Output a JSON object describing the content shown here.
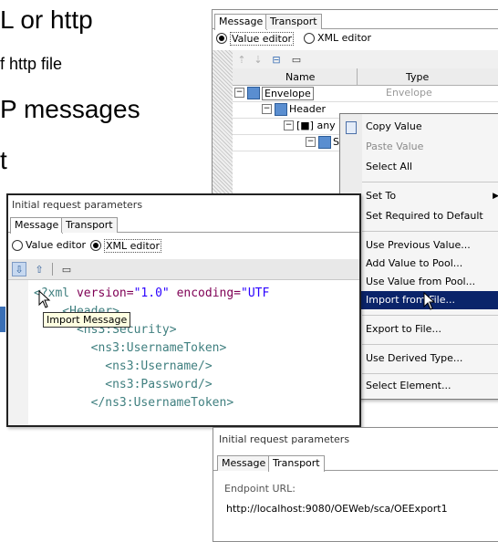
{
  "background_text": {
    "line1": "L or http",
    "line2": "f http file",
    "line3": "P messages",
    "line4": "t"
  },
  "top_window": {
    "tabs": [
      "Message",
      "Transport"
    ],
    "radio_value_editor": "Value editor",
    "radio_xml_editor": "XML editor",
    "columns": {
      "name": "Name",
      "type": "Type"
    },
    "rows": [
      {
        "label": "Envelope",
        "type": "Envelope"
      },
      {
        "label": "Header",
        "type": ""
      },
      {
        "label": "[■] any",
        "type": ""
      },
      {
        "label": "S",
        "type": ""
      }
    ]
  },
  "context_menu": {
    "items": [
      {
        "label": "Copy Value",
        "disabled": false
      },
      {
        "label": "Paste Value",
        "disabled": true
      },
      {
        "label": "Select All",
        "disabled": false
      },
      {
        "label": "Set To",
        "disabled": false,
        "submenu": true
      },
      {
        "label": "Set Required to Default",
        "disabled": false
      },
      {
        "label": "Use Previous Value...",
        "disabled": false
      },
      {
        "label": "Add Value to Pool...",
        "disabled": false
      },
      {
        "label": "Use Value from Pool...",
        "disabled": false
      },
      {
        "label": "Import from File...",
        "disabled": false,
        "highlighted": true
      },
      {
        "label": "Export to File...",
        "disabled": false
      },
      {
        "label": "Use Derived Type...",
        "disabled": false
      },
      {
        "label": "Select Element...",
        "disabled": false
      }
    ]
  },
  "middle_window": {
    "title": "Initial request parameters",
    "tabs": [
      "Message",
      "Transport"
    ],
    "radio_value_editor": "Value editor",
    "radio_xml_editor": "XML editor",
    "tooltip": "Import Message",
    "code_lines": [
      "<?xml version=\"1.0\" encoding=\"UTF",
      "    <Header>",
      "      <ns3:Security>",
      "        <ns3:UsernameToken>",
      "          <ns3:Username/>",
      "          <ns3:Password/>",
      "        </ns3:UsernameToken>"
    ]
  },
  "bottom_window": {
    "title": "Initial request parameters",
    "tabs": [
      "Message",
      "Transport"
    ],
    "endpoint_label": "Endpoint URL:",
    "endpoint_value": "http://localhost:9080/OEWeb/sca/OEExport1"
  },
  "colors": {
    "menu_highlight": "#0a246a",
    "xml_attr": "#7f0055",
    "xml_string": "#2a00ff",
    "xml_tag": "#3f7f7f"
  }
}
